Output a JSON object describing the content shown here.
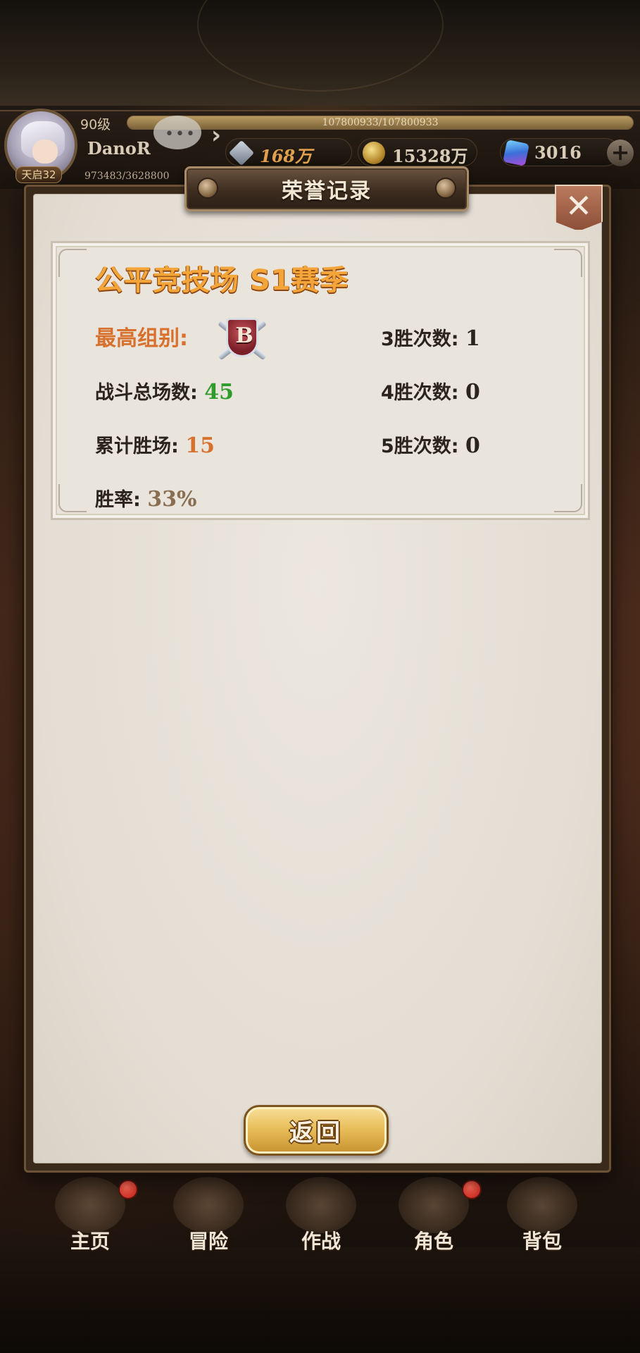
{
  "hud": {
    "level": "90级",
    "hp_text": "107800933/107800933",
    "hp_fraction": 1.0,
    "player_name": "DanoR",
    "exp_text": "973483/3628800",
    "avatar_badge": "天启32",
    "power": "168万",
    "gold": "15328万",
    "gems": "3016",
    "plus": "+"
  },
  "dialog": {
    "title": "荣誉记录",
    "close_symbol": "✕",
    "record": {
      "season_title": "公平竞技场  S1赛季",
      "highest_group_label": "最高组别:",
      "highest_group_value": "B",
      "total_battles_label": "战斗总场数:",
      "total_battles_value": "45",
      "total_wins_label": "累计胜场:",
      "total_wins_value": "15",
      "win_rate_label": "胜率:",
      "win_rate_value": "33%",
      "wins3_label": "3胜次数:",
      "wins3_value": "1",
      "wins4_label": "4胜次数:",
      "wins4_value": "0",
      "wins5_label": "5胜次数:",
      "wins5_value": "0"
    },
    "return_label": "返回"
  },
  "bottom_nav": {
    "items": [
      {
        "label": "主页",
        "badge": true
      },
      {
        "label": "冒险",
        "badge": false
      },
      {
        "label": "作战",
        "badge": false
      },
      {
        "label": "角色",
        "badge": true
      },
      {
        "label": "背包",
        "badge": false
      }
    ]
  },
  "colors": {
    "accent_orange": "#d8712e",
    "season_gold": "#f3a53a",
    "stat_green": "#2f9b2a",
    "win_rate_tan": "#8a6e52"
  }
}
